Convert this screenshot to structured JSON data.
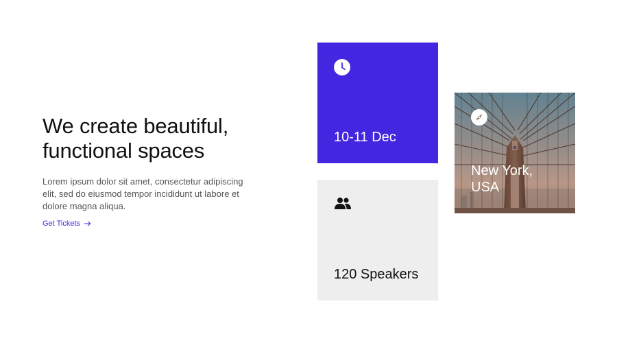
{
  "hero": {
    "title": "We create beautiful, functional spaces",
    "body": "Lorem ipsum dolor sit amet, consectetur adipiscing elit, sed do eiusmod tempor incididunt ut labore et dolore magna aliqua.",
    "cta_label": "Get Tickets"
  },
  "cards": {
    "date": {
      "text": "10-11 Dec",
      "icon": "clock-icon"
    },
    "speakers": {
      "text": "120 Speakers",
      "icon": "people-icon"
    },
    "location": {
      "text": "New York, USA",
      "icon": "compass-icon"
    }
  },
  "colors": {
    "accent": "#4326e0",
    "card_gray": "#eeeeee",
    "text": "#111111",
    "muted": "#555555"
  }
}
